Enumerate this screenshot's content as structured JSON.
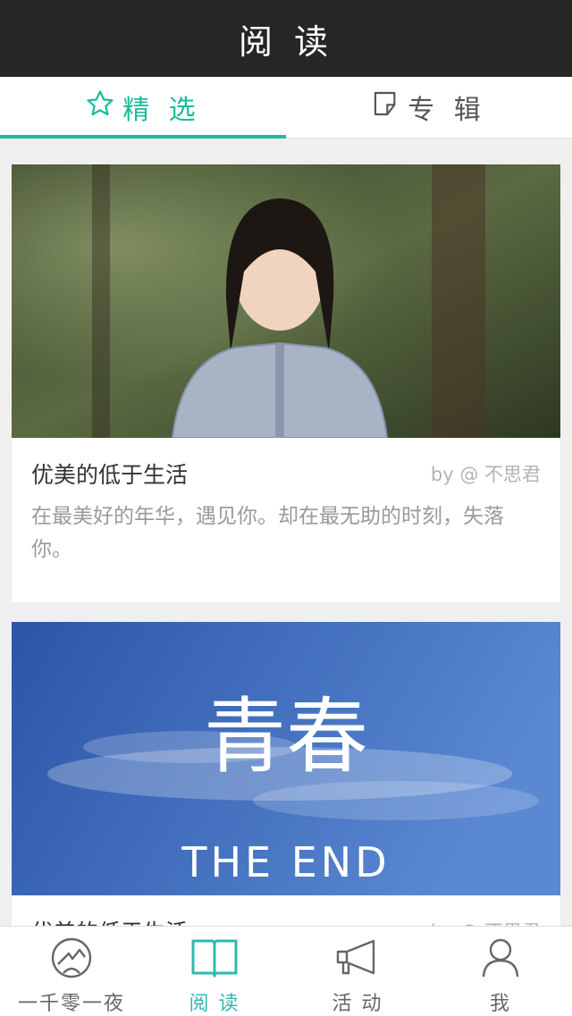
{
  "header": {
    "title": "阅 读"
  },
  "tabs": [
    {
      "label": "精 选",
      "icon": "star-icon",
      "active": true
    },
    {
      "label": "专 辑",
      "icon": "album-icon",
      "active": false
    }
  ],
  "cards": [
    {
      "image": "portrait-photo",
      "title": "优美的低于生活",
      "author": "by @ 不思君",
      "excerpt": "在最美好的年华，遇见你。却在最无助的时刻，失落你。"
    },
    {
      "image": "sky-poster",
      "image_text_main": "青春",
      "image_text_sub": "THE END",
      "title": "优美的低于生活",
      "author": "by @ 不思君"
    }
  ],
  "tabbar": [
    {
      "label": "一千零一夜",
      "icon": "heart-icon",
      "active": false
    },
    {
      "label": "阅 读",
      "icon": "book-icon",
      "active": true
    },
    {
      "label": "活 动",
      "icon": "megaphone-icon",
      "active": false
    },
    {
      "label": "我",
      "icon": "person-icon",
      "active": false
    }
  ],
  "colors": {
    "accent": "#1abc9c",
    "header_bg": "#262626",
    "tabbar_active": "#2fb9b0"
  }
}
